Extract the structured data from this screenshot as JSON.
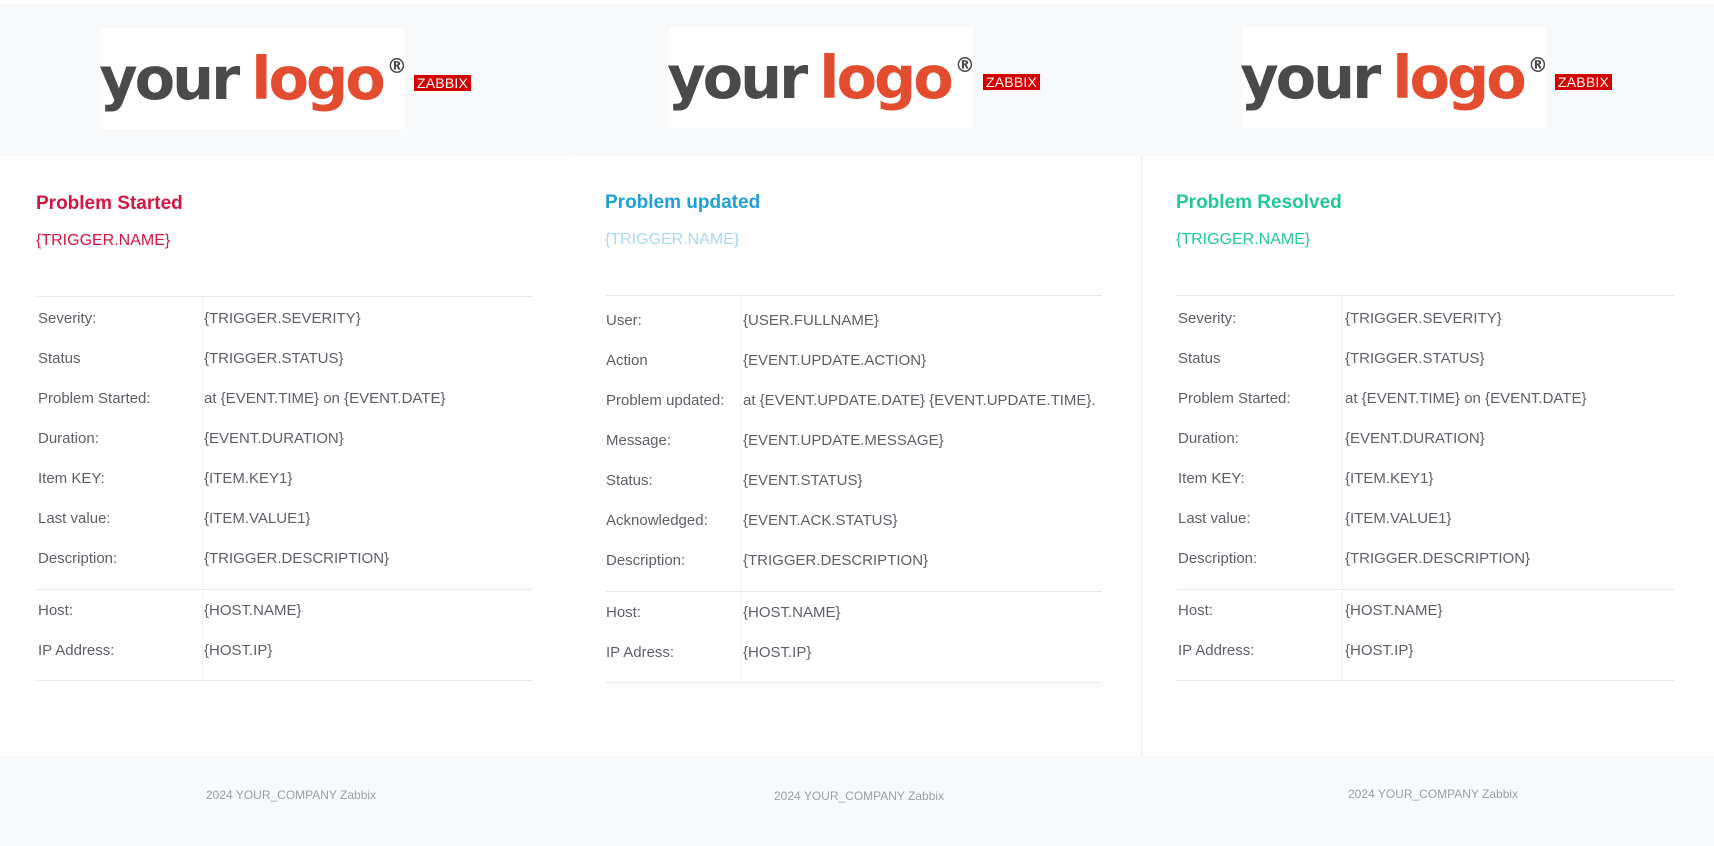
{
  "logo": {
    "word1": "your",
    "word2": "logo",
    "reg": "®",
    "brand_badge": "ZABBIX"
  },
  "colors": {
    "started": "#d3163f",
    "updated": "#1f9fd8",
    "updated_sub": "#a9d8ee",
    "resolved": "#20c997",
    "header_bg": "#f8f9fb",
    "zabbix_red": "#d40000"
  },
  "panels": [
    {
      "title": "Problem Started",
      "subtitle": "{TRIGGER.NAME}",
      "rows": [
        {
          "label": "Severity:",
          "value": "{TRIGGER.SEVERITY}"
        },
        {
          "label": "Status",
          "value": "{TRIGGER.STATUS}"
        },
        {
          "label": "Problem Started:",
          "value": "at {EVENT.TIME} on {EVENT.DATE}"
        },
        {
          "label": "Duration:",
          "value": "{EVENT.DURATION}"
        },
        {
          "label": "Item KEY:",
          "value": "{ITEM.KEY1}"
        },
        {
          "label": "Last value:",
          "value": "{ITEM.VALUE1}"
        },
        {
          "label": "Description:",
          "value": "{TRIGGER.DESCRIPTION}"
        }
      ],
      "host_rows": [
        {
          "label": "Host:",
          "value": "{HOST.NAME}"
        },
        {
          "label": "IP Address:",
          "value": "{HOST.IP}"
        }
      ],
      "footer": "2024 YOUR_COMPANY Zabbix"
    },
    {
      "title": "Problem updated",
      "subtitle": "{TRIGGER.NAME}",
      "rows": [
        {
          "label": "User:",
          "value": "{USER.FULLNAME}"
        },
        {
          "label": "Action",
          "value": "{EVENT.UPDATE.ACTION}"
        },
        {
          "label": "Problem updated:",
          "value": "at {EVENT.UPDATE.DATE} {EVENT.UPDATE.TIME}."
        },
        {
          "label": "Message:",
          "value": "{EVENT.UPDATE.MESSAGE}"
        },
        {
          "label": "Status:",
          "value": "{EVENT.STATUS}"
        },
        {
          "label": "Acknowledged:",
          "value": "{EVENT.ACK.STATUS}"
        },
        {
          "label": "Description:",
          "value": "{TRIGGER.DESCRIPTION}"
        }
      ],
      "host_rows": [
        {
          "label": "Host:",
          "value": "{HOST.NAME}"
        },
        {
          "label": "IP Adress:",
          "value": "{HOST.IP}"
        }
      ],
      "footer": "2024 YOUR_COMPANY Zabbix"
    },
    {
      "title": "Problem Resolved",
      "subtitle": "{TRIGGER.NAME}",
      "rows": [
        {
          "label": "Severity:",
          "value": "{TRIGGER.SEVERITY}"
        },
        {
          "label": "Status",
          "value": "{TRIGGER.STATUS}"
        },
        {
          "label": "Problem Started:",
          "value": "at {EVENT.TIME} on {EVENT.DATE}"
        },
        {
          "label": "Duration:",
          "value": "{EVENT.DURATION}"
        },
        {
          "label": "Item KEY:",
          "value": "{ITEM.KEY1}"
        },
        {
          "label": "Last value:",
          "value": "{ITEM.VALUE1}"
        },
        {
          "label": "Description:",
          "value": "{TRIGGER.DESCRIPTION}"
        }
      ],
      "host_rows": [
        {
          "label": "Host:",
          "value": "{HOST.NAME}"
        },
        {
          "label": "IP Address:",
          "value": "{HOST.IP}"
        }
      ],
      "footer": "2024 YOUR_COMPANY Zabbix"
    }
  ]
}
